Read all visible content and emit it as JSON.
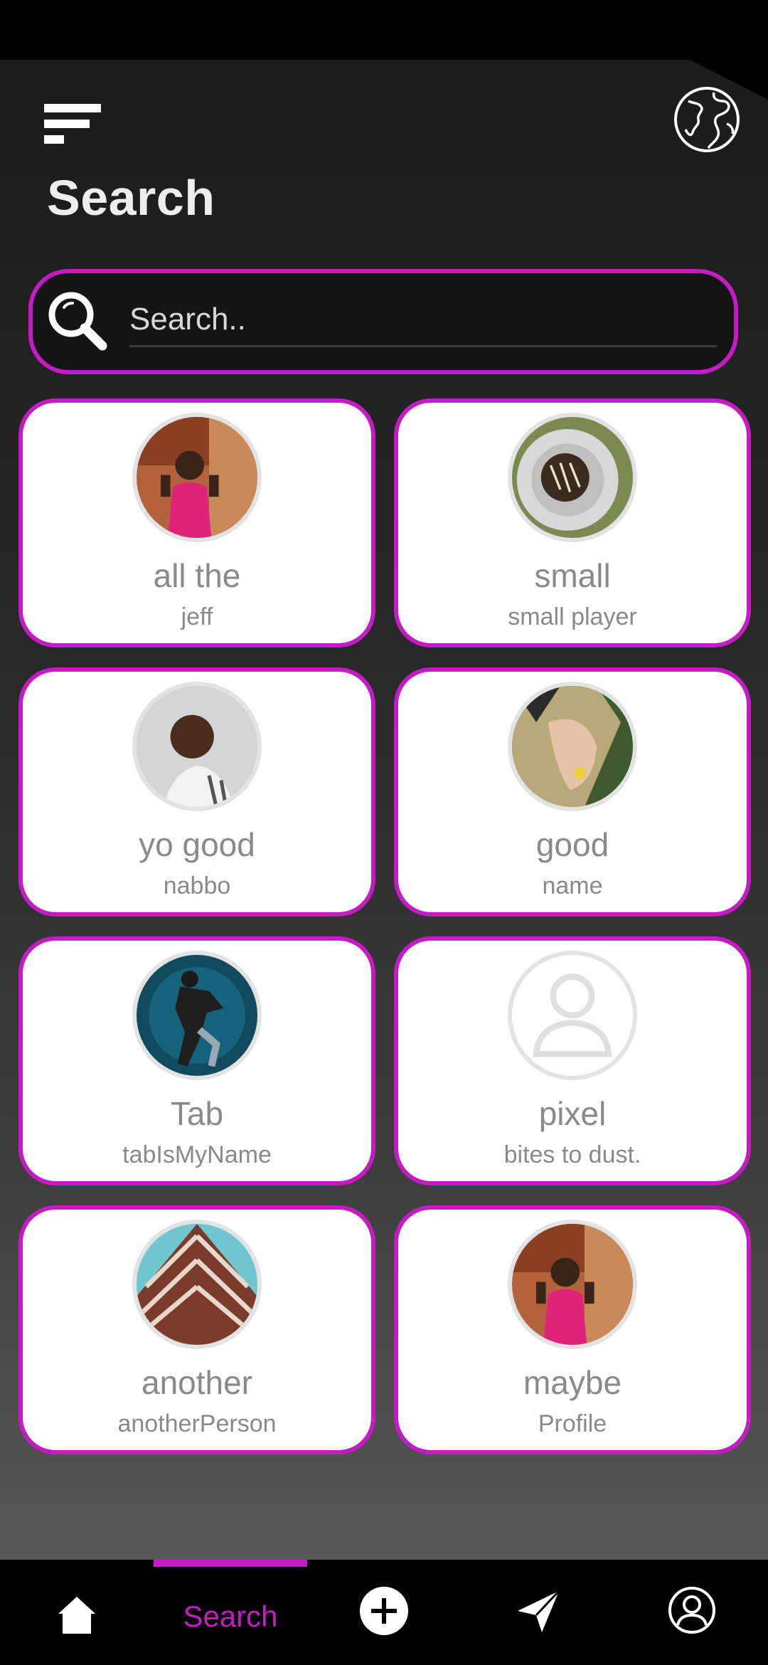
{
  "header": {
    "title": "Search",
    "menu_icon": "menu-lines-icon",
    "globe_icon": "globe-icon"
  },
  "search": {
    "placeholder": "Search..",
    "value": ""
  },
  "profiles": [
    {
      "name": "all the",
      "username": "jeff"
    },
    {
      "name": "small",
      "username": "small player"
    },
    {
      "name": "yo good",
      "username": "nabbo"
    },
    {
      "name": "good",
      "username": "name"
    },
    {
      "name": "Tab",
      "username": "tabIsMyName"
    },
    {
      "name": "pixel",
      "username": "bites to dust."
    },
    {
      "name": "another",
      "username": "anotherPerson"
    },
    {
      "name": "maybe",
      "username": "Profile"
    }
  ],
  "bottom_nav": {
    "items": [
      {
        "icon": "home-icon"
      },
      {
        "label": "Search",
        "active": true
      },
      {
        "icon": "add-circle-icon"
      },
      {
        "icon": "send-icon"
      },
      {
        "icon": "profile-icon"
      }
    ]
  },
  "colors": {
    "accent": "#c51bc5",
    "card_bg": "#ffffff",
    "text_muted": "#8a8a8a"
  }
}
